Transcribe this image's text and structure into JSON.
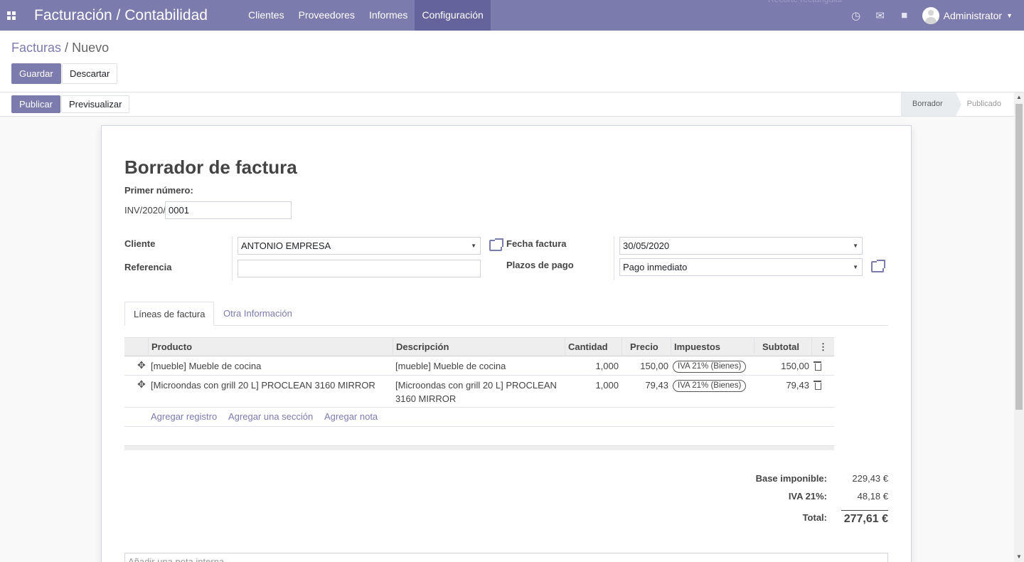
{
  "topbar": {
    "app_title": "Facturación / Contabilidad",
    "menu": [
      {
        "label": "Clientes"
      },
      {
        "label": "Proveedores"
      },
      {
        "label": "Informes"
      },
      {
        "label": "Configuración"
      }
    ],
    "faded_overlay": "Recorte rectangular",
    "user": "Administrator",
    "icons": [
      "clock-icon",
      "chat-icon",
      "gift-icon"
    ]
  },
  "breadcrumb": {
    "parent": "Facturas",
    "separator": "/",
    "current": "Nuevo"
  },
  "actions": {
    "save": "Guardar",
    "discard": "Descartar"
  },
  "status_actions": {
    "publish": "Publicar",
    "preview": "Previsualizar"
  },
  "status_steps": {
    "draft": "Borrador",
    "posted": "Publicado"
  },
  "form": {
    "title": "Borrador de factura",
    "first_number_label": "Primer número:",
    "prefix": "INV/2020/",
    "number": "0001",
    "customer_label": "Cliente",
    "customer_value": "ANTONIO EMPRESA",
    "reference_label": "Referencia",
    "reference_value": "",
    "date_label": "Fecha factura",
    "date_value": "30/05/2020",
    "terms_label": "Plazos de pago",
    "terms_value": "Pago inmediato"
  },
  "tabs": {
    "lines": "Líneas de factura",
    "other": "Otra Información"
  },
  "table": {
    "headers": {
      "product": "Producto",
      "description": "Descripción",
      "quantity": "Cantidad",
      "price": "Precio",
      "taxes": "Impuestos",
      "subtotal": "Subtotal"
    },
    "rows": [
      {
        "product": "[mueble] Mueble de cocina",
        "description": "[mueble] Mueble de cocina",
        "quantity": "1,000",
        "price": "150,00",
        "tax": "IVA 21% (Bienes)",
        "subtotal": "150,00"
      },
      {
        "product": "[Microondas con grill 20 L] PROCLEAN 3160 MIRROR",
        "description_line1": "[Microondas con grill 20 L] PROCLEAN",
        "description_line2": "3160 MIRROR",
        "quantity": "1,000",
        "price": "79,43",
        "tax": "IVA 21% (Bienes)",
        "subtotal": "79,43"
      }
    ],
    "add_links": {
      "record": "Agregar registro",
      "section": "Agregar una sección",
      "note": "Agregar nota"
    }
  },
  "totals": {
    "base_label": "Base imponible:",
    "base_value": "229,43 €",
    "vat_label": "IVA 21%:",
    "vat_value": "48,18 €",
    "total_label": "Total:",
    "total_value": "277,61 €"
  },
  "note_placeholder": "Añadir una nota interna..."
}
